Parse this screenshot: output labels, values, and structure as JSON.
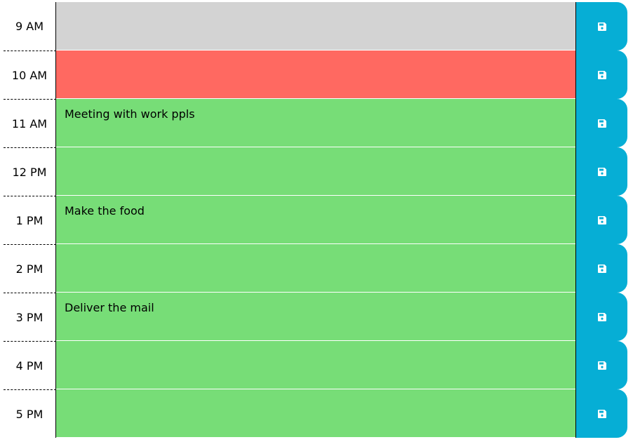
{
  "colors": {
    "past": "#d3d3d3",
    "present": "#ff6961",
    "future": "#77dd77",
    "save_button": "#06aed5"
  },
  "rows": [
    {
      "hour": "9 AM",
      "text": "",
      "status": "past",
      "save_icon": "floppy-disk-icon"
    },
    {
      "hour": "10 AM",
      "text": "",
      "status": "present",
      "save_icon": "floppy-disk-icon"
    },
    {
      "hour": "11 AM",
      "text": "Meeting with work ppls",
      "status": "future",
      "save_icon": "floppy-disk-icon"
    },
    {
      "hour": "12 PM",
      "text": "",
      "status": "future",
      "save_icon": "floppy-disk-icon"
    },
    {
      "hour": "1 PM",
      "text": "Make the food",
      "status": "future",
      "save_icon": "floppy-disk-icon"
    },
    {
      "hour": "2 PM",
      "text": "",
      "status": "future",
      "save_icon": "floppy-disk-icon"
    },
    {
      "hour": "3 PM",
      "text": "Deliver the mail",
      "status": "future",
      "save_icon": "floppy-disk-icon"
    },
    {
      "hour": "4 PM",
      "text": "",
      "status": "future",
      "save_icon": "floppy-disk-icon"
    },
    {
      "hour": "5 PM",
      "text": "",
      "status": "future",
      "save_icon": "floppy-disk-icon"
    }
  ]
}
